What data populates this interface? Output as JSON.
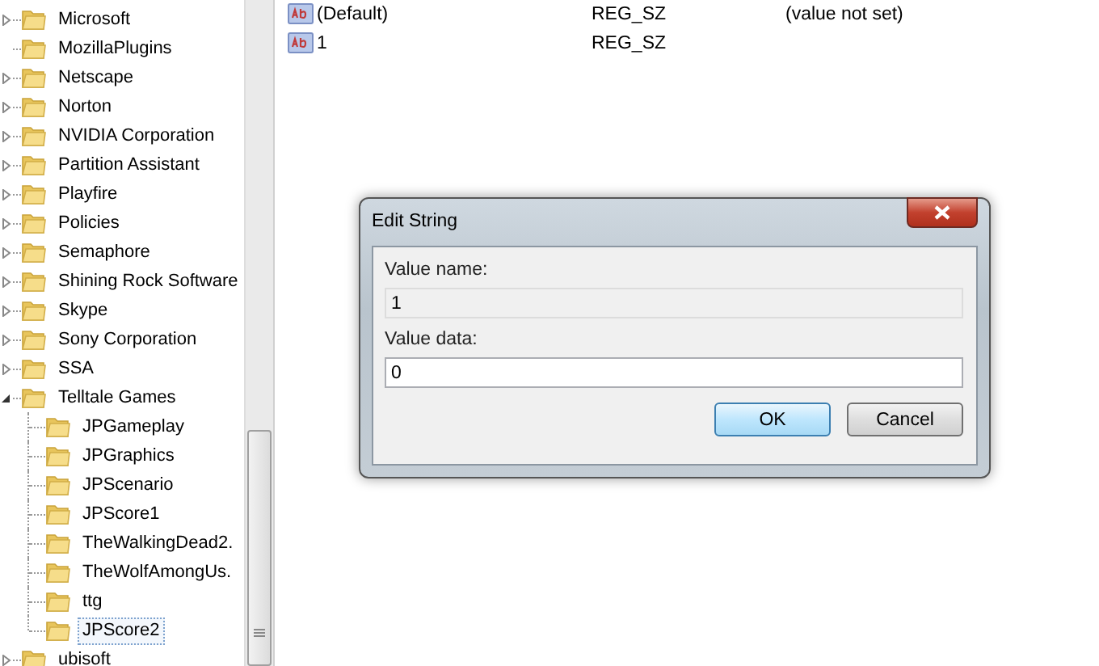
{
  "tree": {
    "items": [
      {
        "label": "Microsoft",
        "expandable": true
      },
      {
        "label": "MozillaPlugins",
        "expandable": false
      },
      {
        "label": "Netscape",
        "expandable": true
      },
      {
        "label": "Norton",
        "expandable": true
      },
      {
        "label": "NVIDIA Corporation",
        "expandable": true
      },
      {
        "label": "Partition Assistant",
        "expandable": true
      },
      {
        "label": "Playfire",
        "expandable": true
      },
      {
        "label": "Policies",
        "expandable": true
      },
      {
        "label": "Semaphore",
        "expandable": true
      },
      {
        "label": "Shining Rock Software",
        "expandable": true
      },
      {
        "label": "Skype",
        "expandable": true
      },
      {
        "label": "Sony Corporation",
        "expandable": true
      },
      {
        "label": "SSA",
        "expandable": true
      },
      {
        "label": "Telltale Games",
        "expandable": true,
        "children": [
          {
            "label": "JPGameplay",
            "selected": false
          },
          {
            "label": "JPGraphics",
            "selected": false
          },
          {
            "label": "JPScenario",
            "selected": false
          },
          {
            "label": "JPScore1",
            "selected": false
          },
          {
            "label": "TheWalkingDead2.",
            "selected": false
          },
          {
            "label": "TheWolfAmongUs.",
            "selected": false
          },
          {
            "label": "ttg",
            "selected": false
          },
          {
            "label": "JPScore2",
            "selected": true
          }
        ]
      },
      {
        "label": "ubisoft",
        "expandable": true
      }
    ]
  },
  "values": {
    "rows": [
      {
        "name": "(Default)",
        "type": "REG_SZ",
        "data": "(value not set)"
      },
      {
        "name": "1",
        "type": "REG_SZ"
      }
    ]
  },
  "dialog": {
    "title": "Edit String",
    "fields": [
      {
        "label": "Value name:",
        "value": "1",
        "disabled": true
      },
      {
        "label": "Value data:",
        "value": "0",
        "disabled": false
      }
    ],
    "buttons": [
      {
        "label": "OK",
        "default": true
      },
      {
        "label": "Cancel",
        "default": false
      }
    ]
  }
}
